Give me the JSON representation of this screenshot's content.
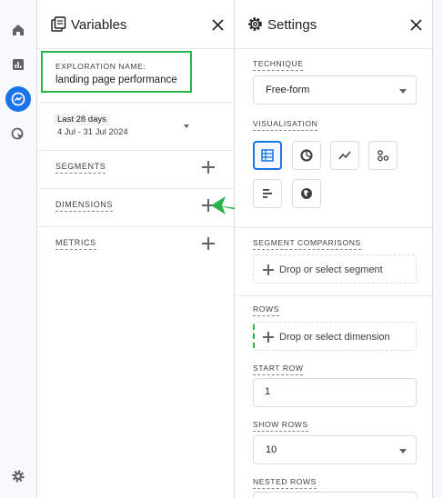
{
  "nav_rail": {
    "items": [
      {
        "icon": "home-icon"
      },
      {
        "icon": "reports-icon"
      },
      {
        "icon": "explore-icon",
        "active": true
      },
      {
        "icon": "advertising-icon"
      }
    ],
    "bottom_icon": "admin-gear-icon"
  },
  "variables": {
    "title": "Variables",
    "exploration_name_label": "EXPLORATION NAME:",
    "exploration_name_value": "landing page performance",
    "date_chip": "Last 28 days",
    "date_range": "4 Jul - 31 Jul 2024",
    "segments_label": "SEGMENTS",
    "dimensions_label": "DIMENSIONS",
    "metrics_label": "METRICS"
  },
  "settings": {
    "title": "Settings",
    "technique_label": "TECHNIQUE",
    "technique_value": "Free-form",
    "visualisation_label": "VISUALISATION",
    "visualisation_options": [
      {
        "icon": "table-icon",
        "active": true
      },
      {
        "icon": "donut-chart-icon"
      },
      {
        "icon": "line-chart-icon"
      },
      {
        "icon": "scatter-plot-icon"
      },
      {
        "icon": "bar-chart-icon"
      },
      {
        "icon": "geo-map-icon"
      }
    ],
    "segment_comparisons_label": "SEGMENT COMPARISONS",
    "segment_drop_text": "Drop or select segment",
    "rows_label": "ROWS",
    "rows_drop_text": "Drop or select dimension",
    "start_row_label": "START ROW",
    "start_row_value": "1",
    "show_rows_label": "SHOW ROWS",
    "show_rows_value": "10",
    "nested_rows_label": "NESTED ROWS"
  },
  "colors": {
    "accent_blue": "#1a73e8",
    "highlight_green": "#2bb24c"
  }
}
